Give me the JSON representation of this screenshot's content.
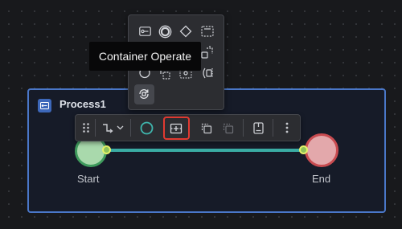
{
  "container": {
    "title": "Process1",
    "border_color": "#4a77c8",
    "icon": "process-icon"
  },
  "nodes": {
    "start": {
      "label": "Start",
      "fill": "#a9d9ac",
      "stroke": "#3f9b5d"
    },
    "end": {
      "label": "End",
      "fill": "#e3a8ab",
      "stroke": "#c84b50"
    }
  },
  "edge": {
    "color": "#3aaca4"
  },
  "tooltip": {
    "text": "Container Operate"
  },
  "toolbar": {
    "items": [
      "drag-handle-icon",
      "edge-type-icon",
      "chevron-down-icon",
      "circle-shape-icon",
      "container-operate-icon",
      "copy-icon",
      "paste-icon",
      "note-icon",
      "more-icon"
    ],
    "highlight_color": "#e23a31"
  },
  "element_panel": {
    "icons": [
      "service-task-icon",
      "end-event-icon",
      "gateway-icon",
      "subprocess-icon",
      "multi-instance-icon",
      "intermediate-event-icon",
      "parallel-task-icon",
      "dashed-task-icon",
      "signal-icon",
      "loop-task-icon"
    ]
  }
}
